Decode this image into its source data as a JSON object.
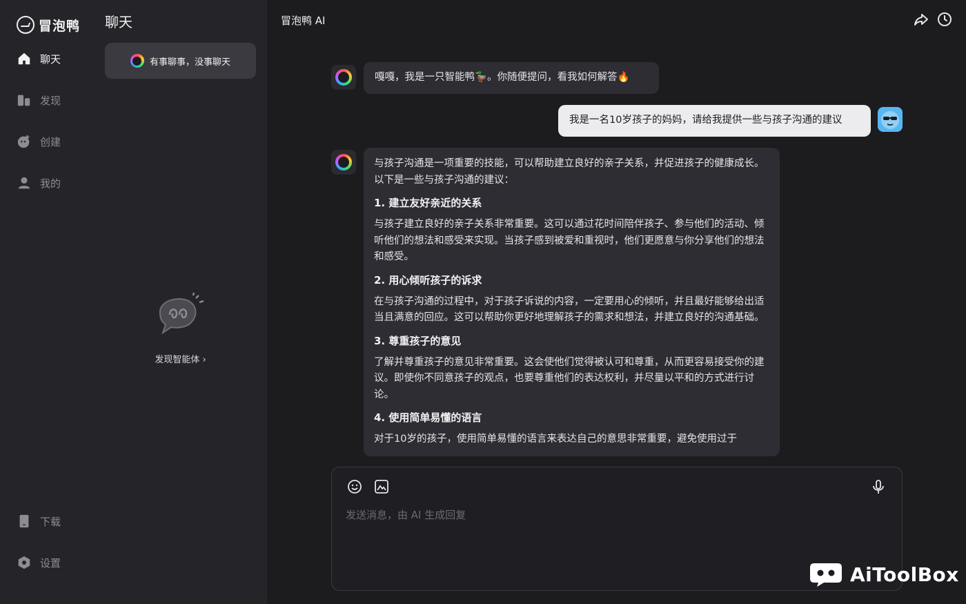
{
  "app": {
    "logo_text": "冒泡鸭"
  },
  "nav": {
    "items": [
      {
        "label": "聊天",
        "icon": "home-icon",
        "active": true
      },
      {
        "label": "发现",
        "icon": "discover-icon",
        "active": false
      },
      {
        "label": "创建",
        "icon": "create-icon",
        "active": false
      },
      {
        "label": "我的",
        "icon": "user-icon",
        "active": false
      }
    ],
    "bottom": [
      {
        "label": "下载",
        "icon": "phone-icon"
      },
      {
        "label": "设置",
        "icon": "settings-icon"
      }
    ]
  },
  "sidebar": {
    "title": "聊天",
    "chat_item": "有事聊事，没事聊天",
    "discover_link": "发现智能体 ›"
  },
  "main": {
    "title": "冒泡鸭 AI",
    "messages": {
      "greeting": "嘎嘎，我是一只智能鸭🦆。你随便提问，看我如何解答🔥",
      "user": "我是一名10岁孩子的妈妈，请给我提供一些与孩子沟通的建议",
      "response": {
        "intro": "与孩子沟通是一项重要的技能，可以帮助建立良好的亲子关系，并促进孩子的健康成长。以下是一些与孩子沟通的建议：",
        "h1": "1. 建立友好亲近的关系",
        "p1": "与孩子建立良好的亲子关系非常重要。这可以通过花时间陪伴孩子、参与他们的活动、倾听他们的想法和感受来实现。当孩子感到被爱和重视时，他们更愿意与你分享他们的想法和感受。",
        "h2": "2. 用心倾听孩子的诉求",
        "p2": "在与孩子沟通的过程中，对于孩子诉说的内容，一定要用心的倾听，并且最好能够给出适当且满意的回应。这可以帮助你更好地理解孩子的需求和想法，并建立良好的沟通基础。",
        "h3": "3. 尊重孩子的意见",
        "p3": "了解并尊重孩子的意见非常重要。这会使他们觉得被认可和尊重，从而更容易接受你的建议。即使你不同意孩子的观点，也要尊重他们的表达权利，并尽量以平和的方式进行讨论。",
        "h4": "4. 使用简单易懂的语言",
        "p4": "对于10岁的孩子，使用简单易懂的语言来表达自己的意思非常重要，避免使用过于"
      }
    },
    "composer": {
      "placeholder": "发送消息，由 AI 生成回复"
    }
  },
  "watermark": {
    "text": "AiToolBox"
  },
  "colors": {
    "background": "#1c1c1f",
    "panel": "#252529",
    "bubble": "#2d2d33",
    "user_bubble": "#ececee"
  }
}
